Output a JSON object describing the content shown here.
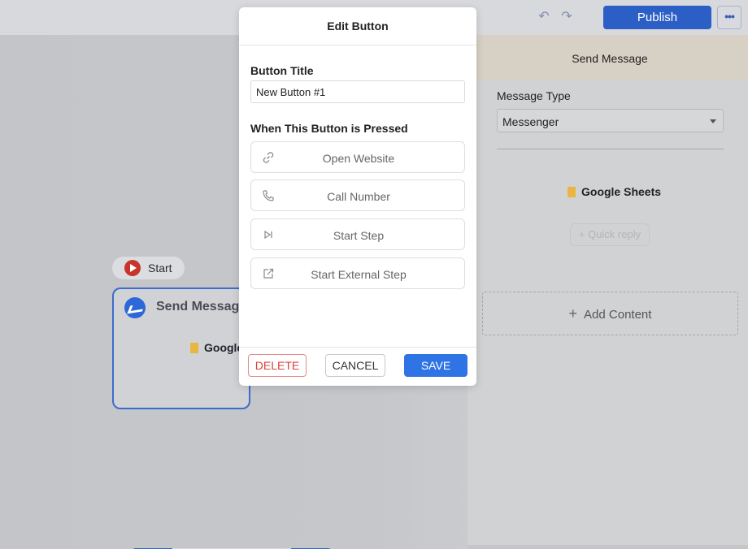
{
  "topbar": {
    "undo_icon": "undo-icon",
    "redo_icon": "redo-icon",
    "publish_label": "Publish",
    "more_icon": "more-horizontal-icon",
    "more_label": "•••"
  },
  "canvas": {
    "start_label": "Start",
    "node": {
      "title": "Send Message",
      "content_label": "Google"
    },
    "zoombar": {
      "play_icon": "play-icon",
      "zoom_in_icon": "zoom-in-icon",
      "zoom_out_icon": "zoom-out-icon",
      "auto_arrange_icon": "sparkle-icon",
      "add_icon": "plus-icon"
    }
  },
  "panel": {
    "title": "Send Message",
    "message_type_label": "Message Type",
    "message_type_value": "Messenger",
    "sheets_label": "Google Sheets",
    "quick_reply_label": "+ Quick reply",
    "add_content_label": "Add Content"
  },
  "modal": {
    "title": "Edit Button",
    "button_title_label": "Button Title",
    "button_title_value": "New Button #1",
    "pressed_label": "When This Button is Pressed",
    "options": [
      {
        "label": "Open Website",
        "icon": "link-icon"
      },
      {
        "label": "Call Number",
        "icon": "phone-icon"
      },
      {
        "label": "Start Step",
        "icon": "skip-forward-icon"
      },
      {
        "label": "Start External Step",
        "icon": "external-link-icon"
      }
    ],
    "delete_label": "DELETE",
    "cancel_label": "CANCEL",
    "save_label": "SAVE"
  },
  "colors": {
    "primary": "#2f74e4",
    "publish": "#2c5fc6",
    "danger": "#d9433b",
    "start_icon": "#c7342c",
    "sheets_icon": "#e9b642"
  }
}
